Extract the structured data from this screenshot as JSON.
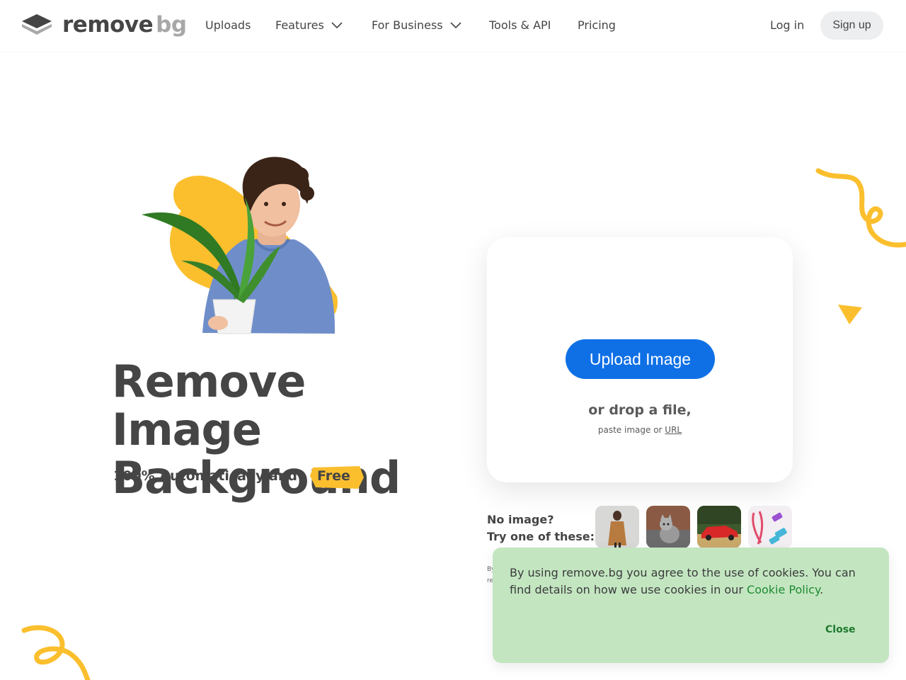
{
  "nav": {
    "logo_main": "remove",
    "logo_accent": "bg",
    "links": [
      {
        "label": "Uploads"
      },
      {
        "label": "Features",
        "dropdown": true
      },
      {
        "label": "For Business",
        "dropdown": true
      },
      {
        "label": "Tools & API"
      },
      {
        "label": "Pricing"
      }
    ],
    "login": "Log in",
    "signup": "Sign up"
  },
  "hero": {
    "title_line1": "Remove Image",
    "title_line2": "Background",
    "subtitle": "100% Automatically and",
    "badge": "Free"
  },
  "upload": {
    "button": "Upload Image",
    "drop_text": "or drop a file,",
    "paste_prefix": "paste image or",
    "paste_link": "URL"
  },
  "samples": {
    "line1": "No image?",
    "line2": "Try one of these:",
    "thumbs": [
      "woman-sample",
      "cat-sample",
      "car-sample",
      "gadget-sample"
    ]
  },
  "terms_snippet": {
    "line1": "By",
    "line2": "re"
  },
  "cookie": {
    "text_prefix": "By using remove.bg you agree to the use of cookies. You can find details on how we use cookies in our",
    "link": "Cookie Policy",
    "suffix": ".",
    "close": "Close"
  },
  "colors": {
    "primary": "#0f70e6",
    "accent_yellow": "#fbbf2e",
    "cookie_bg": "#c3e6c1",
    "text": "#454545"
  }
}
